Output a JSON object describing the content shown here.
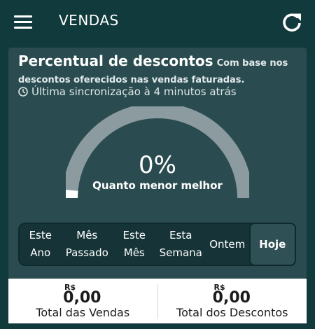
{
  "header": {
    "title": "VENDAS",
    "menu_icon": "hamburger-menu-icon",
    "refresh_icon": "refresh-icon"
  },
  "card": {
    "title": "Percentual de descontos",
    "subtitle": "Com base nos descontos oferecidos nas vendas faturadas.",
    "sync_text": "Última sincronização à 4 minutos atrás",
    "gauge": {
      "value_text": "0%",
      "value": 0,
      "caption": "Quanto menor melhor",
      "track_color": "#8c9ba0",
      "fill_color": "#ffffff"
    },
    "periods": [
      {
        "label": "Este\nAno",
        "active": false
      },
      {
        "label": "Mês\nPassado",
        "active": false
      },
      {
        "label": "Este\nMês",
        "active": false
      },
      {
        "label": "Esta\nSemana",
        "active": false
      },
      {
        "label": "Ontem",
        "active": false
      },
      {
        "label": "Hoje",
        "active": true
      }
    ]
  },
  "totals": {
    "sales": {
      "currency": "R$",
      "amount": "0,00",
      "label": "Total das Vendas"
    },
    "discounts": {
      "currency": "R$",
      "amount": "0,00",
      "label": "Total dos Descontos"
    }
  },
  "colors": {
    "background": "#113a3c",
    "card": "#2a4c50",
    "period_bar": "#163437",
    "period_active": "#2f5054"
  }
}
